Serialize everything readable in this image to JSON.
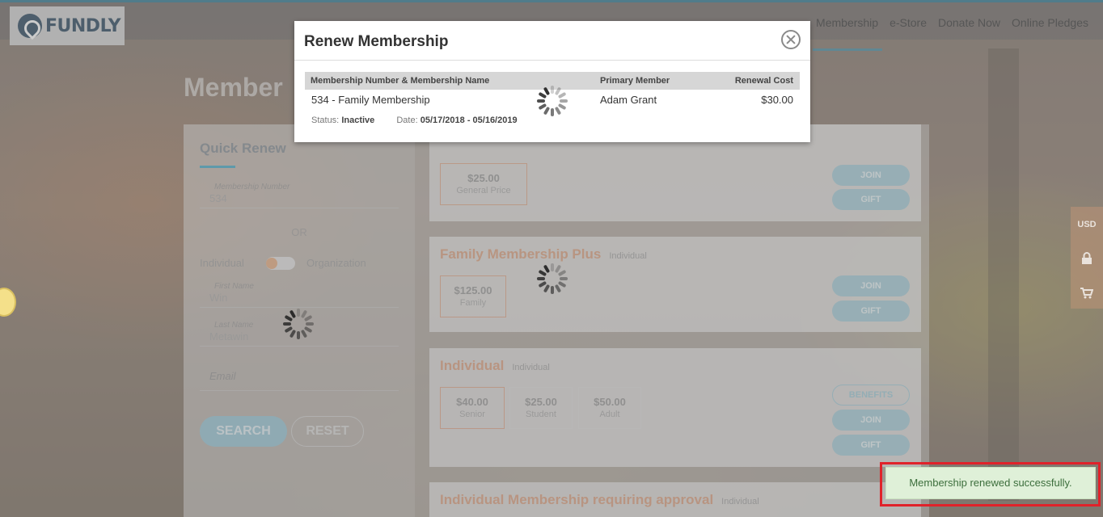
{
  "brand": {
    "logo_text": "FUNDLY"
  },
  "nav": {
    "items": [
      "Membership",
      "e-Store",
      "Donate Now",
      "Online Pledges"
    ]
  },
  "page": {
    "title": "Member"
  },
  "quick_renew": {
    "title": "Quick Renew",
    "membership_number_label": "Membership Number",
    "membership_number_value": "534",
    "or_text": "OR",
    "toggle_left": "Individual",
    "toggle_right": "Organization",
    "first_name_label": "First Name",
    "first_name_value": "Win",
    "last_name_label": "Last Name",
    "last_name_value": "Metawin",
    "email_placeholder": "Email",
    "search_label": "SEARCH",
    "reset_label": "RESET"
  },
  "cards": [
    {
      "title": "",
      "subtitle": "",
      "prices": [
        {
          "amount": "$25.00",
          "label": "General Price",
          "selected": true
        }
      ],
      "buttons": [
        "JOIN",
        "GIFT"
      ]
    },
    {
      "title": "Family Membership Plus",
      "subtitle": "Individual",
      "prices": [
        {
          "amount": "$125.00",
          "label": "Family",
          "selected": true
        }
      ],
      "buttons": [
        "JOIN",
        "GIFT"
      ]
    },
    {
      "title": "Individual",
      "subtitle": "Individual",
      "prices": [
        {
          "amount": "$40.00",
          "label": "Senior",
          "selected": true
        },
        {
          "amount": "$25.00",
          "label": "Student",
          "selected": false
        },
        {
          "amount": "$50.00",
          "label": "Adult",
          "selected": false
        }
      ],
      "buttons": [
        "BENEFITS",
        "JOIN",
        "GIFT"
      ]
    },
    {
      "title": "Individual Membership requiring approval",
      "subtitle": "Individual"
    }
  ],
  "side_widget": {
    "currency": "USD",
    "lock_icon": "lock-icon",
    "cart_icon": "cart-icon"
  },
  "modal": {
    "title": "Renew Membership",
    "columns": {
      "membership": "Membership Number & Membership Name",
      "primary": "Primary Member",
      "cost": "Renewal Cost"
    },
    "row": {
      "membership": "534 - Family Membership",
      "primary": "Adam Grant",
      "cost": "$30.00",
      "status_label": "Status:",
      "status_value": "Inactive",
      "date_label": "Date:",
      "date_value": "05/17/2018 - 05/16/2019"
    }
  },
  "toast": {
    "message": "Membership renewed successfully."
  },
  "colors": {
    "accent": "#2d8aa6",
    "highlight_border": "#e0222a",
    "toast_bg": "#dff0d8"
  }
}
